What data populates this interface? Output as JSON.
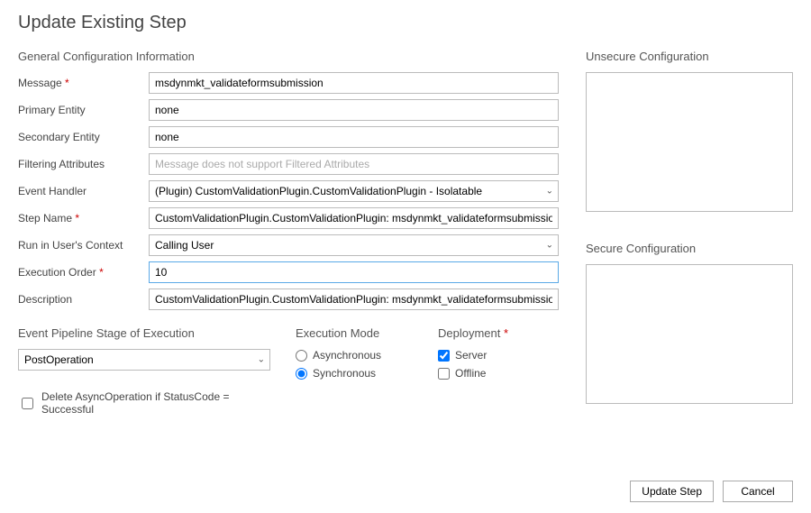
{
  "title": "Update Existing Step",
  "general": {
    "heading": "General Configuration Information",
    "message_label": "Message",
    "message_value": "msdynmkt_validateformsubmission",
    "primary_entity_label": "Primary Entity",
    "primary_entity_value": "none",
    "secondary_entity_label": "Secondary Entity",
    "secondary_entity_value": "none",
    "filtering_label": "Filtering Attributes",
    "filtering_placeholder": "Message does not support Filtered Attributes",
    "event_handler_label": "Event Handler",
    "event_handler_value": "(Plugin) CustomValidationPlugin.CustomValidationPlugin - Isolatable",
    "step_name_label": "Step Name",
    "step_name_value": "CustomValidationPlugin.CustomValidationPlugin: msdynmkt_validateformsubmission of any Ent",
    "run_context_label": "Run in User's Context",
    "run_context_value": "Calling User",
    "exec_order_label": "Execution Order",
    "exec_order_value": "10",
    "description_label": "Description",
    "description_value": "CustomValidationPlugin.CustomValidationPlugin: msdynmkt_validateformsubmission of any Ent"
  },
  "pipeline": {
    "heading": "Event Pipeline Stage of Execution",
    "value": "PostOperation"
  },
  "exec_mode": {
    "heading": "Execution Mode",
    "async_label": "Asynchronous",
    "sync_label": "Synchronous",
    "selected": "sync"
  },
  "deployment": {
    "heading": "Deployment",
    "server_label": "Server",
    "offline_label": "Offline",
    "server_checked": true,
    "offline_checked": false
  },
  "delete_async_label": "Delete AsyncOperation if StatusCode = Successful",
  "unsecure": {
    "heading": "Unsecure  Configuration",
    "value": ""
  },
  "secure": {
    "heading": "Secure  Configuration",
    "value": ""
  },
  "footer": {
    "update_label": "Update Step",
    "cancel_label": "Cancel"
  }
}
